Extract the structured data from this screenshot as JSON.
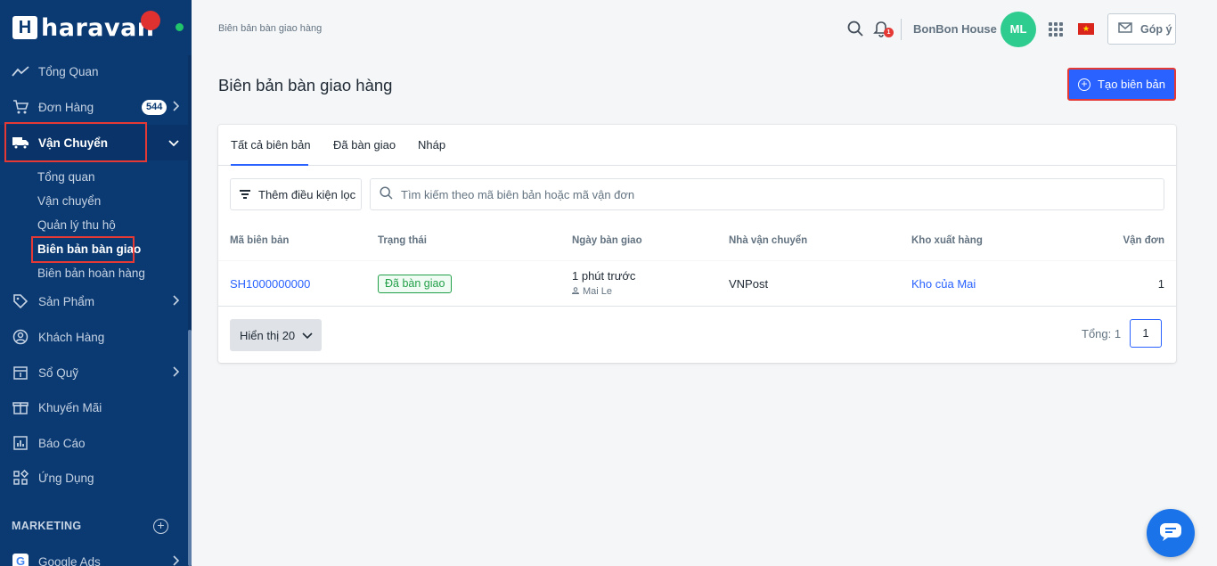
{
  "sidebar": {
    "brand": "haravan",
    "items": [
      {
        "label": "Tổng Quan"
      },
      {
        "label": "Đơn Hàng",
        "badge": "544"
      },
      {
        "label": "Vận Chuyển"
      },
      {
        "label": "Sản Phẩm"
      },
      {
        "label": "Khách Hàng"
      },
      {
        "label": "Sổ Quỹ"
      },
      {
        "label": "Khuyến Mãi"
      },
      {
        "label": "Báo Cáo"
      },
      {
        "label": "Ứng Dụng"
      }
    ],
    "shipping_sub": [
      {
        "label": "Tổng quan"
      },
      {
        "label": "Vận chuyển"
      },
      {
        "label": "Quản lý thu hộ"
      },
      {
        "label": "Biên bản bàn giao"
      },
      {
        "label": "Biên bản hoàn hàng"
      }
    ],
    "marketing_title": "MARKETING",
    "marketing_items": [
      {
        "label": "Google Ads"
      }
    ]
  },
  "header": {
    "breadcrumb": "Biên bản bàn giao hàng",
    "shop_name": "BonBon House",
    "avatar_initials": "ML",
    "notification_count": "1",
    "feedback_label": "Góp ý"
  },
  "page": {
    "title": "Biên bản bàn giao hàng",
    "create_button": "Tạo biên bản"
  },
  "tabs": [
    {
      "label": "Tất cả biên bản"
    },
    {
      "label": "Đã bàn giao"
    },
    {
      "label": "Nháp"
    }
  ],
  "filter": {
    "button_label": "Thêm điều kiện lọc",
    "search_placeholder": "Tìm kiếm theo mã biên bản hoặc mã vận đơn"
  },
  "table": {
    "columns": [
      "Mã biên bản",
      "Trạng thái",
      "Ngày bàn giao",
      "Nhà vận chuyển",
      "Kho xuất hàng",
      "Vận đơn"
    ],
    "rows": [
      {
        "code": "SH1000000000",
        "status": "Đã bàn giao",
        "date": "1 phút trước",
        "user": "Mai Le",
        "carrier": "VNPost",
        "warehouse": "Kho của Mai",
        "waybills": "1"
      }
    ]
  },
  "pagination": {
    "page_size_label": "Hiển thị 20",
    "total_label": "Tổng: 1",
    "current_page": "1"
  },
  "colors": {
    "sidebar_bg": "#0b3a73",
    "accent": "#2962ff",
    "highlight": "#e53935",
    "success": "#22a049"
  }
}
